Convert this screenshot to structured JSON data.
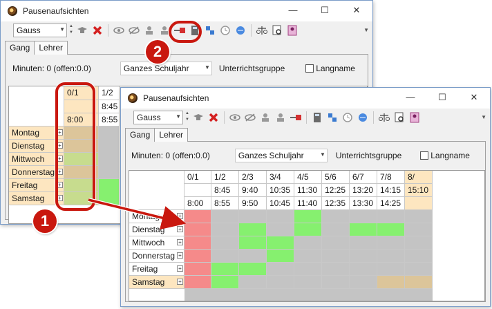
{
  "back_window": {
    "title": "Pausenaufsichten",
    "minimize": "—",
    "maximize": "☐",
    "close": "✕",
    "teacher_value": "Gauss",
    "tabs": [
      "Gang",
      "Lehrer"
    ],
    "minutes_label": "Minuten: 0 (offen:0.0)",
    "period_value": "Ganzes Schuljahr",
    "group_label": "Unterrichtsgruppe",
    "longname_label": "Langname",
    "col_headers": [
      "0/1",
      "1/2"
    ],
    "times_row1": [
      "",
      "8:45"
    ],
    "times_row2": [
      "8:00",
      "8:55"
    ],
    "days": [
      "Montag",
      "Dienstag",
      "Mittwoch",
      "Donnerstag",
      "Freitag",
      "Samstag"
    ]
  },
  "front_window": {
    "title": "Pausenaufsichten",
    "minimize": "—",
    "maximize": "☐",
    "close": "✕",
    "teacher_value": "Gauss",
    "tabs": [
      "Gang",
      "Lehrer"
    ],
    "minutes_label": "Minuten: 0 (offen:0.0)",
    "period_value": "Ganzes Schuljahr",
    "group_label": "Unterrichtsgruppe",
    "longname_label": "Langname",
    "col_headers": [
      "0/1",
      "1/2",
      "2/3",
      "3/4",
      "4/5",
      "5/6",
      "6/7",
      "7/8",
      "8/"
    ],
    "times_row1": [
      "",
      "8:45",
      "9:40",
      "10:35",
      "11:30",
      "12:25",
      "13:20",
      "14:15",
      "15:10"
    ],
    "times_row2": [
      "8:00",
      "8:55",
      "9:50",
      "10:45",
      "11:40",
      "12:35",
      "13:30",
      "14:25",
      ""
    ],
    "days": [
      "Montag",
      "Dienstag",
      "Mittwoch",
      "Donnerstag",
      "Freitag",
      "Samstag"
    ],
    "cell_states": [
      [
        "red",
        "gray",
        "gray",
        "gray",
        "green",
        "gray",
        "gray",
        "gray",
        "gray"
      ],
      [
        "red",
        "gray",
        "green",
        "gray",
        "green",
        "gray",
        "green",
        "green",
        "gray"
      ],
      [
        "red",
        "gray",
        "green",
        "green",
        "gray",
        "gray",
        "gray",
        "gray",
        "gray"
      ],
      [
        "red",
        "gray",
        "gray",
        "green",
        "gray",
        "gray",
        "gray",
        "gray",
        "gray"
      ],
      [
        "red",
        "green",
        "green",
        "gray",
        "gray",
        "gray",
        "gray",
        "gray",
        "gray"
      ],
      [
        "red",
        "green",
        "gray",
        "gray",
        "gray",
        "gray",
        "gray",
        "tan",
        "tan"
      ]
    ]
  },
  "callouts": [
    "1",
    "2"
  ],
  "colors": {
    "red_cell": "#f58a8a",
    "green_cell": "#86f06f",
    "gray_cell": "#c4c4c4",
    "tan_cell": "#dcc59a",
    "callout": "#c9180f"
  }
}
